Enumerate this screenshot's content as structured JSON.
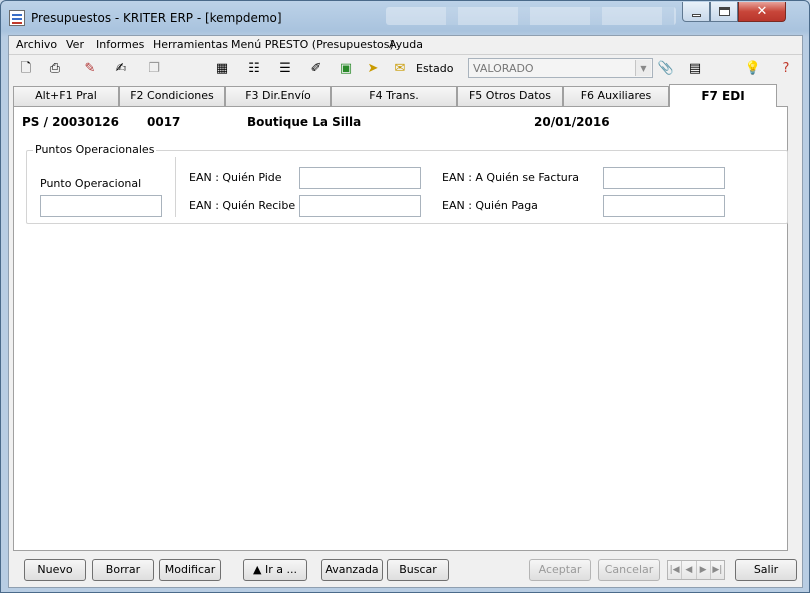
{
  "window": {
    "title": "Presupuestos - KRITER ERP - [kempdemo]"
  },
  "menu": {
    "items": [
      "Archivo",
      "Ver",
      "Informes",
      "Herramientas",
      "Menú PRESTO (Presupuestos)",
      "Ayuda"
    ]
  },
  "toolbar": {
    "estado_label": "Estado",
    "estado_value": "VALORADO"
  },
  "tabs": [
    {
      "label": "Alt+F1 Pral"
    },
    {
      "label": "F2 Condiciones"
    },
    {
      "label": "F3 Dir.Envío"
    },
    {
      "label": "F4 Trans."
    },
    {
      "label": "F5 Otros Datos"
    },
    {
      "label": "F6 Auxiliares"
    },
    {
      "label": "F7 EDI",
      "active": true
    }
  ],
  "header": {
    "doc_ref": "PS / 20030126",
    "client_code": "0017",
    "client_name": "Boutique La Silla",
    "date": "20/01/2016"
  },
  "group": {
    "legend": "Puntos Operacionales",
    "punto_operacional_label": "Punto Operacional",
    "punto_operacional_value": "",
    "ean_pide_label": "EAN : Quién Pide",
    "ean_pide_value": "",
    "ean_recibe_label": "EAN : Quién Recibe",
    "ean_recibe_value": "",
    "ean_factura_label": "EAN : A Quién se Factura",
    "ean_factura_value": "",
    "ean_paga_label": "EAN : Quién Paga",
    "ean_paga_value": ""
  },
  "buttons": {
    "nuevo": "Nuevo",
    "borrar": "Borrar",
    "modificar": "Modificar",
    "ir_a": "▲ Ir a ...",
    "avanzada": "Avanzada",
    "buscar": "Buscar",
    "aceptar": "Aceptar",
    "cancelar": "Cancelar",
    "salir": "Salir"
  },
  "colors": {
    "title_bar": "#b3cae2",
    "close_button": "#c8463a",
    "disabled_text": "#9a9a9a"
  }
}
